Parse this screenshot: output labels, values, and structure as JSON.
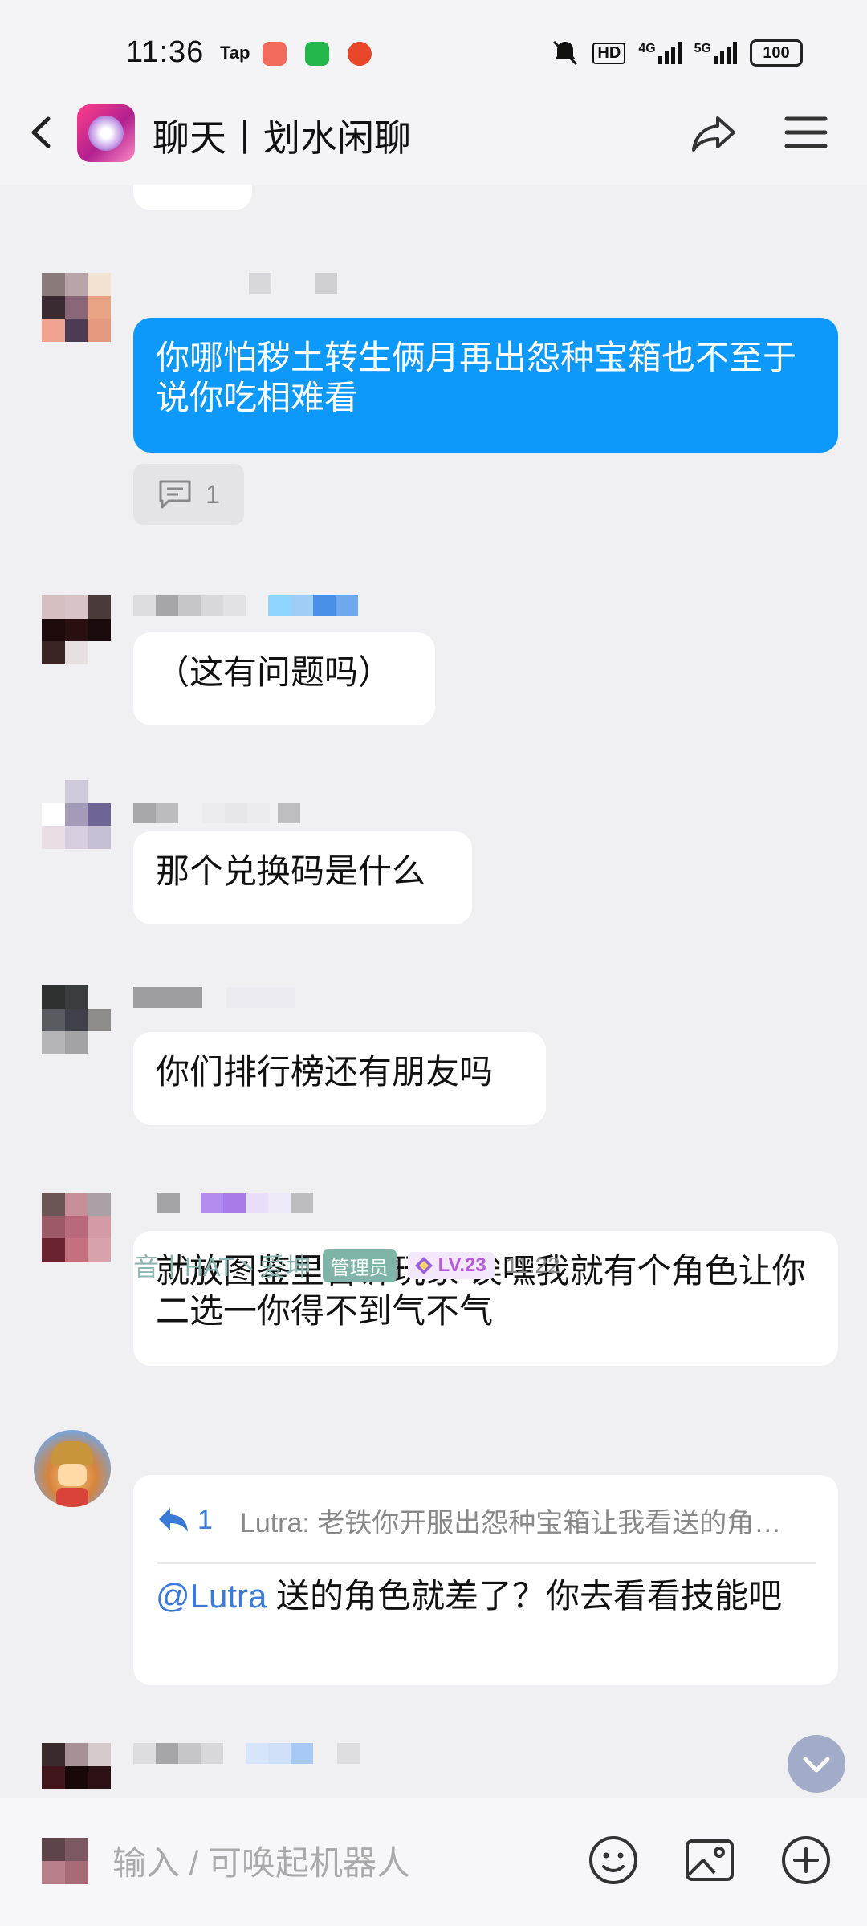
{
  "status_bar": {
    "time": "11:36",
    "tap_label": "Tap",
    "battery": "100",
    "network": [
      "4G",
      "5G"
    ],
    "hd_label": "HD"
  },
  "header": {
    "title": "聊天丨划水闲聊",
    "icons": [
      "back-arrow-icon",
      "share-icon",
      "menu-icon"
    ]
  },
  "messages": [
    {
      "text": "你哪怕秽土转生俩月再出怨种宝箱也不至于说你吃相难看",
      "reply_count": "1",
      "style": "highlight"
    },
    {
      "text": "（这有问题吗）"
    },
    {
      "text": "那个兑换码是什么"
    },
    {
      "text": "你们排行榜还有朋友吗"
    },
    {
      "text": "就放图鉴里告诉玩家 诶嘿我就有个角色让你二选一你得不到气不气"
    },
    {
      "sender": "音丨HAT丶爱坤",
      "role": "管理员",
      "level": "LV.23",
      "time": "11:22",
      "quote_count": "1",
      "quote": "Lutra: 老铁你开服出怨种宝箱让我看送的角…",
      "mention": "@Lutra",
      "text": " 送的角色就差了？你去看看技能吧"
    }
  ],
  "input": {
    "placeholder": "输入 / 可唤起机器人",
    "icons": [
      "emoji-icon",
      "image-icon",
      "plus-icon"
    ]
  },
  "colors": {
    "highlight_bubble": "#0d99fa",
    "mention": "#3a7ad9",
    "admin_tag": "#7fb4a8",
    "level_tag": "#b45cd8"
  }
}
